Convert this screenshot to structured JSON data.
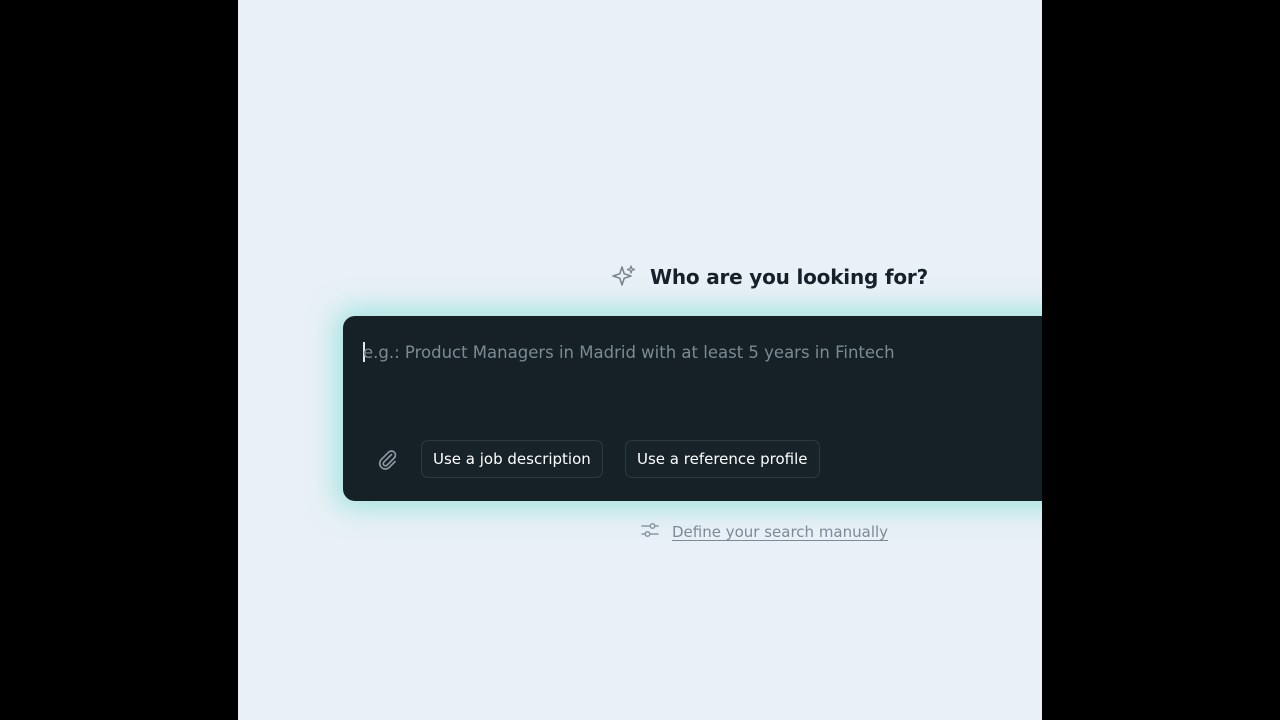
{
  "heading": {
    "title": "Who are you looking for?",
    "icon": "sparkle-icon"
  },
  "search": {
    "value": "",
    "placeholder": "e.g.: Product Managers in Madrid with at least 5 years in Fintech"
  },
  "actions": {
    "attach_icon": "paperclip-icon",
    "job_description_label": "Use a job description",
    "reference_profile_label": "Use a reference profile"
  },
  "manual": {
    "icon": "sliders-icon",
    "label": "Define your search manually"
  },
  "colors": {
    "page_background": "#e9f0f7",
    "card_background": "#152126",
    "glow": "#6edccd",
    "heading_text": "#16202a",
    "link_text": "#7b8a96"
  }
}
